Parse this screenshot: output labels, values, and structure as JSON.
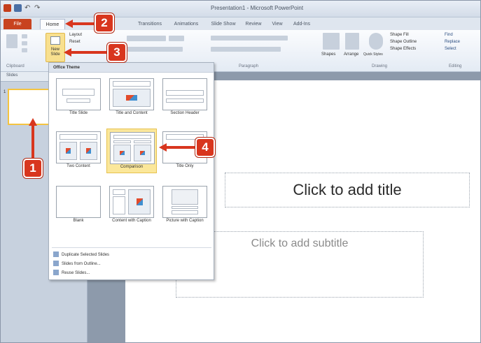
{
  "window": {
    "title": "Presentation1 - Microsoft PowerPoint"
  },
  "tabs": [
    {
      "label": "File"
    },
    {
      "label": "Home"
    },
    {
      "label": "Transitions"
    },
    {
      "label": "Animations"
    },
    {
      "label": "Slide Show"
    },
    {
      "label": "Review"
    },
    {
      "label": "View"
    },
    {
      "label": "Add-Ins"
    }
  ],
  "ribbon": {
    "new_slide": "New Slide",
    "layout": "Layout",
    "reset": "Reset",
    "find": "Find",
    "replace": "Replace",
    "select": "Select",
    "shape_fill": "Shape Fill",
    "shape_outline": "Shape Outline",
    "shape_effects": "Shape Effects",
    "shapes": "Shapes",
    "arrange": "Arrange",
    "quick_styles": "Quick Styles",
    "groups": {
      "clipboard": "Clipboard",
      "paragraph": "Paragraph",
      "drawing": "Drawing",
      "editing": "Editing"
    }
  },
  "left_pane": {
    "tab_slides": "Slides",
    "slide_number": "1"
  },
  "gallery": {
    "header": "Office Theme",
    "layouts": [
      {
        "name": "Title Slide"
      },
      {
        "name": "Title and Content"
      },
      {
        "name": "Section Header"
      },
      {
        "name": "Two Content"
      },
      {
        "name": "Comparison"
      },
      {
        "name": "Title Only"
      },
      {
        "name": "Blank"
      },
      {
        "name": "Content with Caption"
      },
      {
        "name": "Picture with Caption"
      }
    ],
    "commands": [
      {
        "label": "Duplicate Selected Slides"
      },
      {
        "label": "Slides from Outline..."
      },
      {
        "label": "Reuse Slides..."
      }
    ]
  },
  "slide": {
    "title_placeholder": "Click to add title",
    "subtitle_placeholder": "Click to add subtitle"
  },
  "callouts": {
    "one": "1",
    "two": "2",
    "three": "3",
    "four": "4"
  },
  "colors": {
    "callout": "#d8361e",
    "file_tab": "#c8431f",
    "selected_layout": "#fbe79a"
  }
}
